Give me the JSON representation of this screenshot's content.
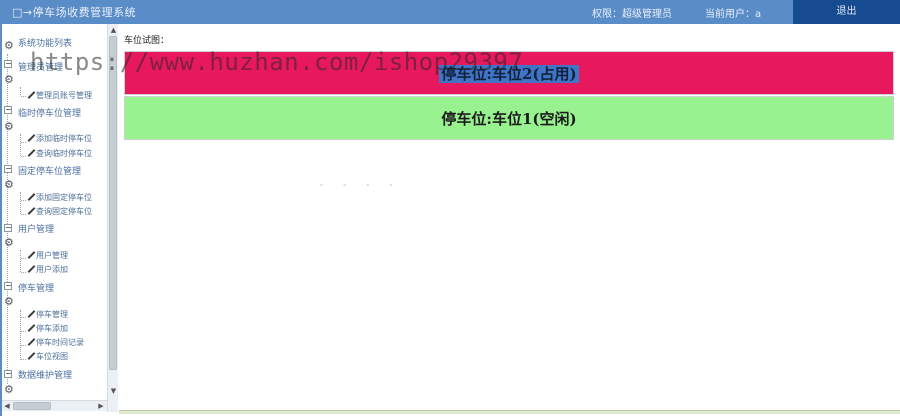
{
  "header": {
    "title": "□→停车场收费管理系统",
    "permission": "权限：超级管理员",
    "current_user": "当前用户：a",
    "exit_label": "退出"
  },
  "sidebar": {
    "root": "系统功能列表",
    "groups": [
      {
        "label": "管理员管理",
        "items": [
          "管理员账号管理"
        ]
      },
      {
        "label": "临时停车位管理",
        "items": [
          "添加临时停车位",
          "查询临时停车位"
        ]
      },
      {
        "label": "固定停车位管理",
        "items": [
          "添加固定停车位",
          "查询固定停车位"
        ]
      },
      {
        "label": "用户管理",
        "items": [
          "用户管理",
          "用户添加"
        ]
      },
      {
        "label": "停车管理",
        "items": [
          "停车管理",
          "停车添加",
          "停车时间记录",
          "车位视图"
        ]
      },
      {
        "label": "数据维护管理",
        "items": []
      }
    ]
  },
  "main": {
    "view_label": "车位试图：",
    "slots": [
      {
        "text": "停车位:车位2(占用)",
        "status": "occupied",
        "color": "#e8185e"
      },
      {
        "text": "停车位:车位1(空闲)",
        "status": "free",
        "color": "#98f28f"
      }
    ]
  },
  "watermark": "https://www.huzhan.com/ishop29397"
}
